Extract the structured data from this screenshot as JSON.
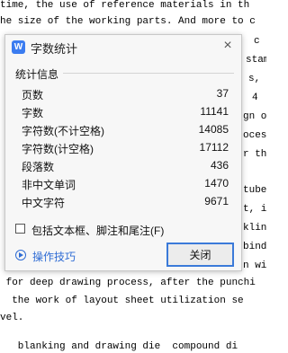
{
  "document": {
    "lines": [
      "time, the use of reference materials in th",
      "he size of the working parts. And more to c",
      " for deep drawing process, after the punchi",
      "  the work of layout sheet utilization se",
      "vel.",
      "   blanking and drawing die  compound di"
    ],
    "fragments": [
      "c",
      "stamp",
      "s,",
      "4",
      "gn o",
      "oces",
      "r th",
      "tube",
      "t, i",
      "klin",
      "binde",
      "n wi",
      "e ",
      "ind"
    ]
  },
  "dialog": {
    "title": "字数统计",
    "app_icon": "W",
    "close_icon": "×",
    "section_header": "统计信息",
    "stats": [
      {
        "label": "页数",
        "value": "37"
      },
      {
        "label": "字数",
        "value": "11141"
      },
      {
        "label": "字符数(不计空格)",
        "value": "14085"
      },
      {
        "label": "字符数(计空格)",
        "value": "17112"
      },
      {
        "label": "段落数",
        "value": "436"
      },
      {
        "label": "非中文单词",
        "value": "1470"
      },
      {
        "label": "中文字符",
        "value": "9671"
      }
    ],
    "checkbox_label": "包括文本框、脚注和尾注(F)",
    "checkbox_checked": false,
    "tips_label": "操作技巧",
    "close_button_label": "关闭"
  },
  "colors": {
    "accent": "#3b7ad9",
    "link": "#2f6cd4",
    "dialog_bg": "#f7f7f7"
  }
}
